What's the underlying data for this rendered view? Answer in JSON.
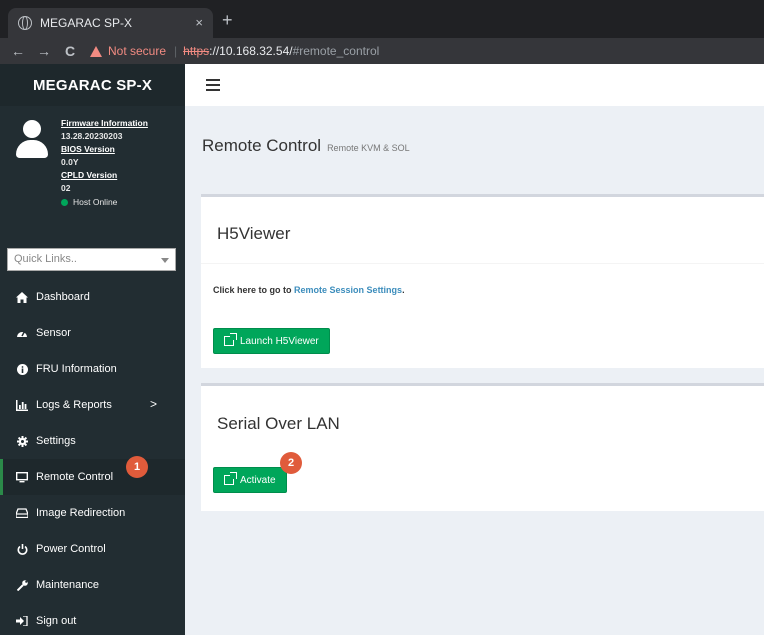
{
  "browser": {
    "tab_title": "MEGARAC SP-X",
    "tab_close": "×",
    "new_tab": "+",
    "back": "←",
    "forward": "→",
    "reload": "C",
    "security_label": "Not secure",
    "url_scheme": "https",
    "url_host": "://10.168.32.54/",
    "url_path": "#remote_control"
  },
  "sidebar": {
    "brand": "MEGARAC SP-X",
    "firmware_label": "Firmware Information",
    "firmware_value": "13.28.20230203",
    "bios_label": "BIOS Version",
    "bios_value": "0.0Y",
    "cpld_label": "CPLD Version",
    "cpld_value": "02",
    "host_status": "Host Online",
    "quicklinks_placeholder": "Quick Links..",
    "items": [
      {
        "label": "Dashboard",
        "icon": "home-icon"
      },
      {
        "label": "Sensor",
        "icon": "tachometer-icon"
      },
      {
        "label": "FRU Information",
        "icon": "info-icon"
      },
      {
        "label": "Logs & Reports",
        "icon": "bar-chart-icon",
        "chevron": ">"
      },
      {
        "label": "Settings",
        "icon": "gear-icon"
      },
      {
        "label": "Remote Control",
        "icon": "monitor-icon",
        "active": true
      },
      {
        "label": "Image Redirection",
        "icon": "drive-icon"
      },
      {
        "label": "Power Control",
        "icon": "power-icon"
      },
      {
        "label": "Maintenance",
        "icon": "wrench-icon"
      },
      {
        "label": "Sign out",
        "icon": "sign-out-icon"
      }
    ]
  },
  "main": {
    "title": "Remote Control",
    "subtitle": "Remote KVM & SOL",
    "h5viewer": {
      "title": "H5Viewer",
      "text_prefix": "Click here to go to",
      "link": "Remote Session Settings",
      "text_suffix": ".",
      "button": "Launch H5Viewer"
    },
    "sol": {
      "title": "Serial Over LAN",
      "button": "Activate"
    }
  },
  "annotations": {
    "step1": "1",
    "step2": "2",
    "color": "#e05b3b"
  }
}
